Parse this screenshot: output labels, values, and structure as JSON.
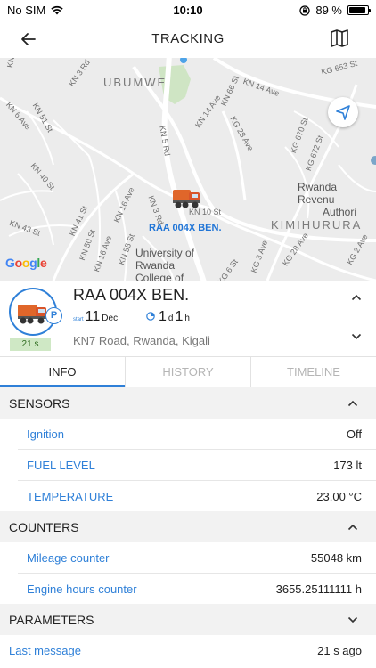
{
  "status_bar": {
    "carrier": "No SIM",
    "time": "10:10",
    "battery": "89 %",
    "battery_level": 0.89
  },
  "header": {
    "title": "TRACKING"
  },
  "map": {
    "area_labels": [
      "UBUMWE",
      "KIMIHURURA"
    ],
    "street_labels": [
      "KN 33 St",
      "KN 3 Rd",
      "KN 14 Ave",
      "KN 6 Ave",
      "KN 51 St",
      "KN 66 St",
      "KN 14 Ave",
      "KG 28 Ave",
      "KG 670 St",
      "KG 672 St",
      "KN 5 Rd",
      "KN 40 St",
      "KN 41 St",
      "KN 16 Ave",
      "KN 3 Rd",
      "KN 10 St",
      "KN 43 St",
      "KN 50 St",
      "KN 16 Ave",
      "KN 55 St",
      "KG 3 Ave",
      "KG 28 Ave",
      "KG 2 Ave",
      "KG 6 St",
      "KG 653 St"
    ],
    "poi_lines": [
      "Rwanda Revenu",
      "Authori"
    ],
    "poi_university": [
      "University of",
      "Rwanda",
      "College of"
    ],
    "vehicle_label": "RAA 004X BEN.",
    "attribution": "Google"
  },
  "vehicle": {
    "name": "RAA 004X BEN.",
    "start_label": "start",
    "start_day": "11",
    "start_month": "Dec",
    "duration_days": "1",
    "duration_days_unit": "d",
    "duration_hours": "1",
    "duration_hours_unit": "h",
    "address": "KN7 Road, Rwanda, Kigali",
    "parking_badge": "P",
    "age": "21 s"
  },
  "tabs": [
    {
      "label": "INFO",
      "active": true
    },
    {
      "label": "HISTORY",
      "active": false
    },
    {
      "label": "TIMELINE",
      "active": false
    }
  ],
  "sensors": {
    "title": "SENSORS",
    "rows": [
      {
        "key": "Ignition",
        "value": "Off"
      },
      {
        "key": "FUEL LEVEL",
        "value": "173 lt"
      },
      {
        "key": "TEMPERATURE",
        "value": "23.00 °C"
      }
    ]
  },
  "counters": {
    "title": "COUNTERS",
    "rows": [
      {
        "key": "Mileage counter",
        "value": "55048 km"
      },
      {
        "key": "Engine hours counter",
        "value": "3655.25111111 h"
      }
    ]
  },
  "parameters": {
    "title": "PARAMETERS"
  },
  "last_message": {
    "key": "Last message",
    "value": "21 s ago"
  },
  "colors": {
    "accent": "#2f80d8",
    "age_badge_bg": "#cfe8c5",
    "map_bg": "#ececec",
    "park_green": "#a8d39a"
  }
}
